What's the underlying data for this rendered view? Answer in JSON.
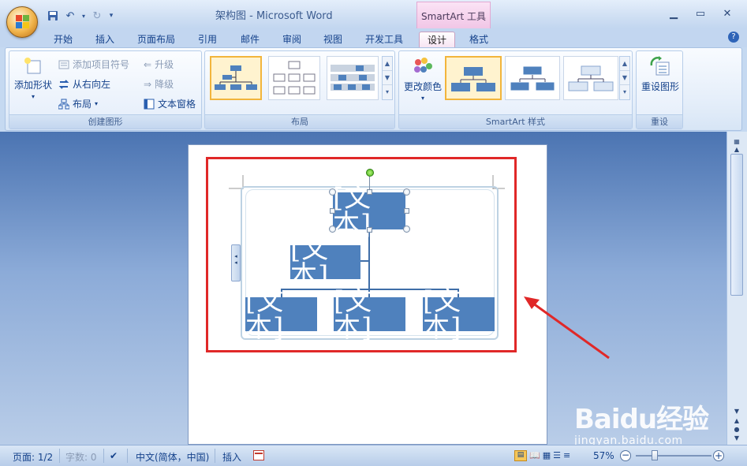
{
  "window": {
    "title": "架构图 - Microsoft Word",
    "context_tab": "SmartArt 工具"
  },
  "tabs": [
    "开始",
    "插入",
    "页面布局",
    "引用",
    "邮件",
    "审阅",
    "视图",
    "开发工具",
    "设计",
    "格式"
  ],
  "active_tab": "设计",
  "ribbon": {
    "create_graphic": {
      "label": "创建图形",
      "add_shape": "添加形状",
      "add_bullet": "添加项目符号",
      "right_to_left": "从右向左",
      "layout": "布局",
      "promote": "升级",
      "demote": "降级",
      "text_pane": "文本窗格"
    },
    "layouts": {
      "label": "布局"
    },
    "styles": {
      "label": "SmartArt 样式",
      "change_colors": "更改颜色"
    },
    "reset": {
      "label": "重设",
      "reset_graphic": "重设图形"
    }
  },
  "smartart": {
    "top_node": "[文本]",
    "assistant_node": "[文本]",
    "child_nodes": [
      "[文本]",
      "[文本]",
      "[文本]"
    ]
  },
  "status": {
    "page": "页面: 1/2",
    "words": "字数: 0",
    "language": "中文(简体，中国)",
    "mode": "插入",
    "zoom": "57%"
  },
  "watermark": {
    "brand": "Baidu经验",
    "url": "jingyan.baidu.com"
  },
  "colors": {
    "node_fill": "#4f81bd",
    "highlight": "#e02828",
    "context_tab": "#f1c6e6"
  }
}
